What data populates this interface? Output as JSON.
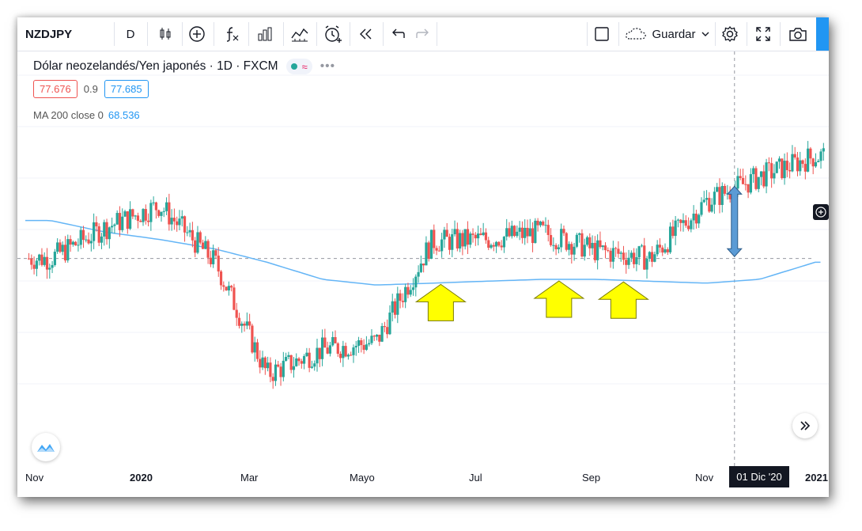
{
  "toolbar": {
    "symbol": "NZDJPY",
    "interval": "D",
    "save_label": "Guardar",
    "icons": [
      "candles-icon",
      "add-indicator-icon",
      "fx-icon",
      "bars-icon",
      "compare-icon",
      "alert-icon",
      "replay-icon",
      "undo-icon",
      "redo-icon",
      "layout-icon",
      "cloud-icon",
      "settings-icon",
      "fullscreen-icon",
      "camera-icon"
    ]
  },
  "legend": {
    "title": "Dólar neozelandés/Yen japonés · 1D · FXCM",
    "pill_symbol": "≈",
    "more": "•••",
    "sell_price": "77.676",
    "spread": "0.9",
    "buy_price": "77.685",
    "ma_label": "MA 200 close 0",
    "ma_value": "68.536"
  },
  "x_axis": {
    "labels": [
      "Nov",
      "2020",
      "Mar",
      "Mayo",
      "Jul",
      "Sep",
      "Nov",
      "2021"
    ],
    "crosshair_date": "01 Dic '20"
  },
  "colors": {
    "up": "#26a69a",
    "down": "#ef5350",
    "ma": "#64b5f6",
    "arrow_yellow": "#ffff00",
    "arrow_blue": "#5b9bd5"
  },
  "chart_data": {
    "type": "candlestick",
    "symbol": "NZDJPY",
    "timeframe": "1D",
    "x": [
      "2019-11",
      "2019-12",
      "2020-01",
      "2020-02",
      "2020-03",
      "2020-04",
      "2020-05",
      "2020-06",
      "2020-07",
      "2020-08",
      "2020-09",
      "2020-10",
      "2020-11",
      "2020-12",
      "2021-01"
    ],
    "series": [
      {
        "name": "NZDJPY",
        "close": [
          69.6,
          71.2,
          72.4,
          69.4,
          63.5,
          64.8,
          65.2,
          70.5,
          70.6,
          71.0,
          70.0,
          69.6,
          72.6,
          73.9,
          75.0
        ]
      },
      {
        "name": "MA 200 close 0",
        "values": [
          71.6,
          71.0,
          70.6,
          70.1,
          69.4,
          68.5,
          68.2,
          68.3,
          68.4,
          68.5,
          68.5,
          68.4,
          68.3,
          68.5,
          69.4
        ]
      }
    ],
    "annotations": [
      {
        "type": "arrow-up",
        "color": "yellow",
        "date": "2020-06-20"
      },
      {
        "type": "arrow-up",
        "color": "yellow",
        "date": "2020-08-25"
      },
      {
        "type": "arrow-up",
        "color": "yellow",
        "date": "2020-09-30"
      },
      {
        "type": "double-arrow",
        "color": "blue",
        "date": "2020-12-01"
      }
    ]
  }
}
